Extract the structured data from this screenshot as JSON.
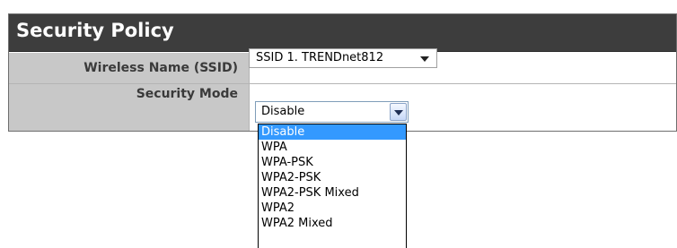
{
  "panel": {
    "title": "Security Policy"
  },
  "ssid": {
    "label": "Wireless Name (SSID)",
    "value": "SSID 1. TRENDnet812"
  },
  "security_mode": {
    "label": "Security Mode",
    "value": "Disable",
    "options": [
      "Disable",
      "WPA",
      "WPA-PSK",
      "WPA2-PSK",
      "WPA2-PSK Mixed",
      "WPA2",
      "WPA2 Mixed"
    ],
    "highlighted_option": "Disable"
  },
  "colors": {
    "header_bg": "#3d3d3d",
    "label_bg": "#c8c8c8",
    "highlight": "#3399ff"
  }
}
